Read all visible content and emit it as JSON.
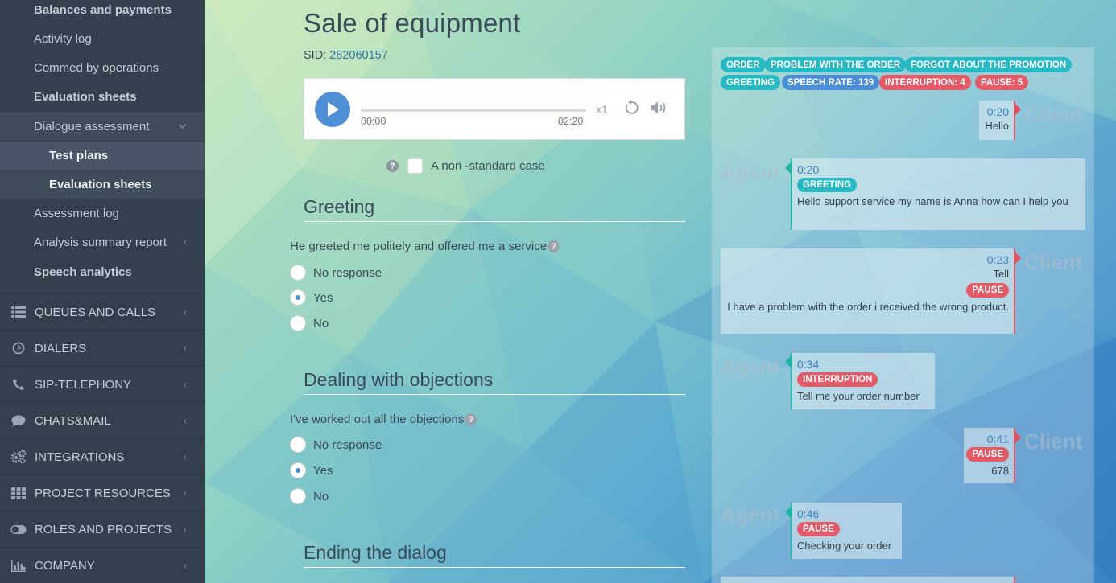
{
  "sidebar": {
    "items": [
      {
        "label": "Balances and payments"
      },
      {
        "label": "Activity log"
      },
      {
        "label": "Commed by operations"
      },
      {
        "label": "Evaluation sheets"
      },
      {
        "label": "Dialogue assessment"
      },
      {
        "label": "Test plans"
      },
      {
        "label": "Evaluation sheets"
      },
      {
        "label": "Assessment log"
      },
      {
        "label": "Analysis summary report"
      },
      {
        "label": "Speech analytics"
      }
    ],
    "sections": [
      {
        "label": "QUEUES AND CALLS",
        "icon": "list-icon"
      },
      {
        "label": "DIALERS",
        "icon": "clock-icon"
      },
      {
        "label": "SIP-TELEPHONY",
        "icon": "phone-icon"
      },
      {
        "label": "CHATS&MAIL",
        "icon": "chat-bubble-icon"
      },
      {
        "label": "INTEGRATIONS",
        "icon": "gears-icon"
      },
      {
        "label": "PROJECT RESOURCES",
        "icon": "grid-icon"
      },
      {
        "label": "ROLES AND PROJECTS",
        "icon": "toggle-icon"
      },
      {
        "label": "COMPANY",
        "icon": "bar-chart-icon"
      }
    ]
  },
  "page": {
    "title": "Sale of equipment",
    "sid_label": "SID:",
    "sid_value": "282060157"
  },
  "player": {
    "time_start": "00:00",
    "time_end": "02:20",
    "speed": "x1",
    "progress": 0
  },
  "nonstandard": {
    "label": "A non -standard case",
    "checked": false
  },
  "sections": [
    {
      "title": "Greeting",
      "question": "He greeted me politely and offered me a service",
      "options": [
        "No response",
        "Yes",
        "No"
      ],
      "selected": "Yes"
    },
    {
      "title": "Dealing with objections",
      "question": "I've worked out all the objections",
      "options": [
        "No response",
        "Yes",
        "No"
      ],
      "selected": "Yes"
    },
    {
      "title": "Ending the dialog"
    }
  ],
  "transcript": {
    "tags": [
      {
        "label": "ORDER",
        "color": "#27b9c4"
      },
      {
        "label": "PROBLEM WITH THE ORDER",
        "color": "#27b9c4"
      },
      {
        "label": "FORGOT ABOUT THE PROMOTION",
        "color": "#27b9c4"
      },
      {
        "label": "GREETING",
        "color": "#27b9c4"
      },
      {
        "label": "SPEECH RATE: 139",
        "color": "#4b8ed6"
      },
      {
        "label": "INTERRUPTION: 4",
        "color": "#e25b67"
      },
      {
        "label": "PAUSE: 5",
        "color": "#e25b67"
      }
    ],
    "speakers": {
      "client": "Client",
      "agent": "Agent"
    },
    "messages": [
      {
        "speaker": "client",
        "time": "0:20",
        "text": "Hello"
      },
      {
        "speaker": "agent",
        "time": "0:20",
        "tag": "GREETING",
        "text": "Hello support service my name is Anna how can I help you"
      },
      {
        "speaker": "client",
        "time": "0:23",
        "text": "Tell",
        "tag": "PAUSE",
        "text2": "I have a problem with the order i received the wrong product."
      },
      {
        "speaker": "agent",
        "time": "0:34",
        "tag": "INTERRUPTION",
        "text": "Tell me your order number"
      },
      {
        "speaker": "client",
        "time": "0:41",
        "tag": "PAUSE",
        "text": "678"
      },
      {
        "speaker": "agent",
        "time": "0:46",
        "tag": "PAUSE",
        "text": "Checking your order"
      }
    ]
  }
}
